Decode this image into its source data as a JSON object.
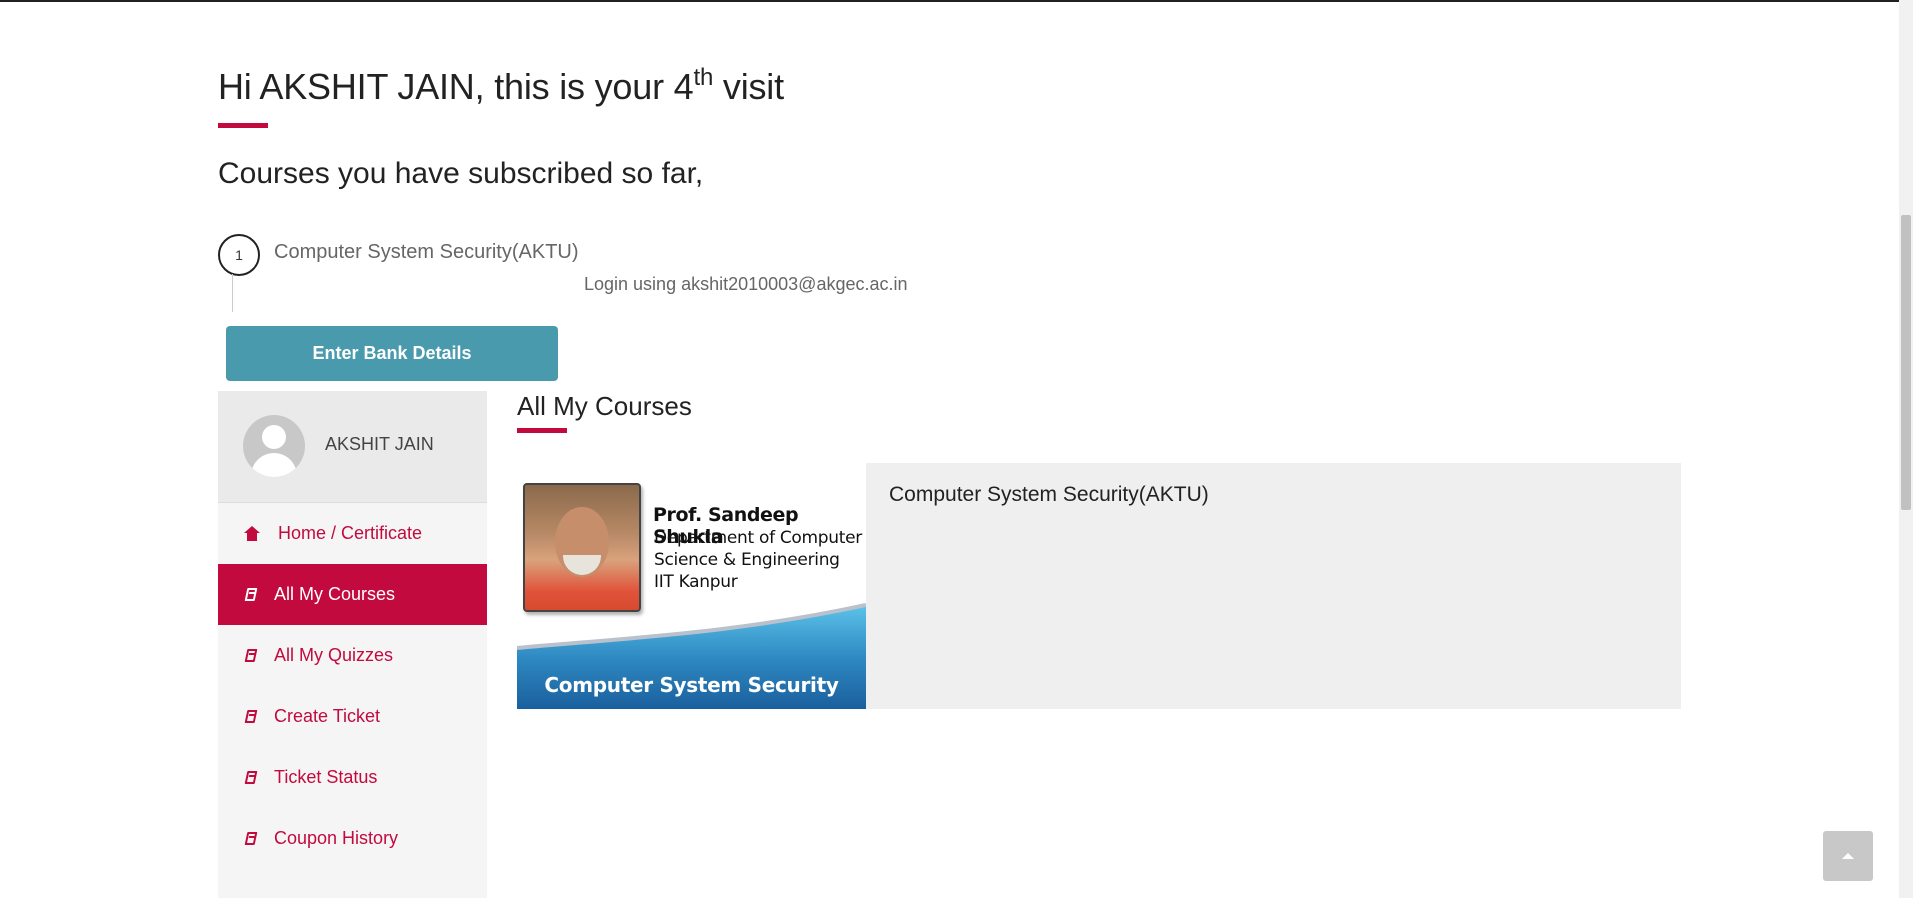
{
  "header": {
    "greeting_prefix": "Hi AKSHIT JAIN, this is your 4",
    "greeting_sup": "th",
    "greeting_suffix": " visit",
    "subtitle": "Courses you have subscribed so far,"
  },
  "subscribed": [
    {
      "index": "1",
      "title": "Computer System Security(AKTU)",
      "login_note": "Login using akshit2010003@akgec.ac.in"
    }
  ],
  "actions": {
    "bank_details_label": "Enter Bank Details"
  },
  "sidebar": {
    "user_name": "AKSHIT JAIN",
    "items": [
      {
        "label": "Home / Certificate",
        "icon": "home-icon",
        "active": false
      },
      {
        "label": "All My Courses",
        "icon": "book-icon",
        "active": true
      },
      {
        "label": "All My Quizzes",
        "icon": "book-icon",
        "active": false
      },
      {
        "label": "Create Ticket",
        "icon": "book-icon",
        "active": false
      },
      {
        "label": "Ticket Status",
        "icon": "book-icon",
        "active": false
      },
      {
        "label": "Coupon History",
        "icon": "book-icon",
        "active": false
      }
    ]
  },
  "main": {
    "section_title": "All My Courses",
    "course_card": {
      "title": "Computer System Security(AKTU)",
      "thumbnail": {
        "instructor": "Prof. Sandeep Shukla",
        "line1": "Department of Computer",
        "line2": "Science & Engineering",
        "line3": "IIT Kanpur",
        "caption": "Computer System Security"
      }
    }
  },
  "colors": {
    "accent": "#c20a3f",
    "button": "#4a9aae",
    "card_bg": "#efefef",
    "sidebar_bg": "#f5f5f5"
  }
}
